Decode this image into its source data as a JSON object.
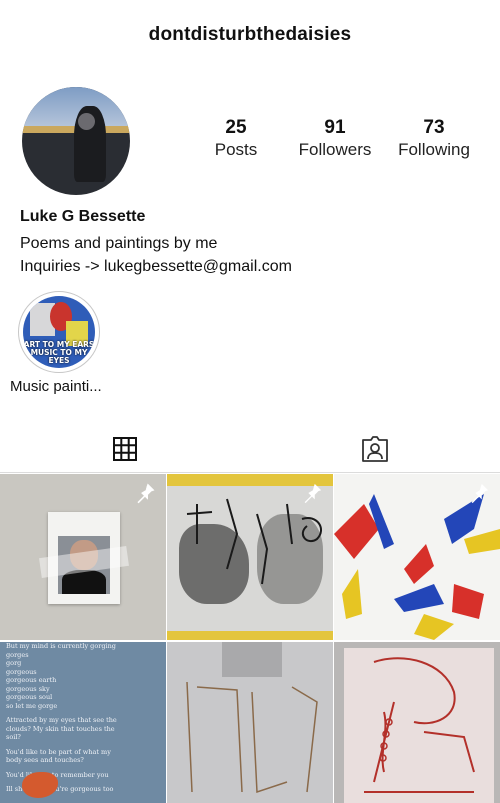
{
  "header": {
    "username": "dontdisturbthedaisies"
  },
  "stats": [
    {
      "count": "25",
      "label": "Posts"
    },
    {
      "count": "91",
      "label": "Followers"
    },
    {
      "count": "73",
      "label": "Following"
    }
  ],
  "bio": {
    "name": "Luke G Bessette",
    "lines": [
      "Poems and paintings by me",
      "Inquiries -> lukegbessette@gmail.com"
    ]
  },
  "highlights": [
    {
      "label": "Music painti...",
      "image_text": "ART TO MY EARS MUSIC TO MY EYES"
    }
  ],
  "tabs": [
    {
      "name": "grid",
      "icon": "grid-icon",
      "active": true
    },
    {
      "name": "tagged",
      "icon": "tagged-person-icon",
      "active": false
    }
  ],
  "posts": [
    {
      "pinned": true
    },
    {
      "pinned": true
    },
    {
      "pinned": true
    },
    {
      "pinned": false,
      "poem_lines": [
        "But my mind is currently gorging",
        "gorges",
        "gorg",
        "gorgeous",
        "gorgeous earth",
        "gorgeous sky",
        "gorgeous soul",
        "so let me gorge",
        "Attracted by my eyes that see the",
        "clouds? My skin that touches the",
        "soil?",
        "You'd like to be part of what my",
        "body sees and touches?",
        "You'd like me to remember you",
        "Ill show you you're gorgeous too"
      ]
    },
    {
      "pinned": false
    },
    {
      "pinned": false
    }
  ],
  "colors": {
    "text": "#111111",
    "divider": "#dcdcdc",
    "pin": "#ffffff"
  }
}
